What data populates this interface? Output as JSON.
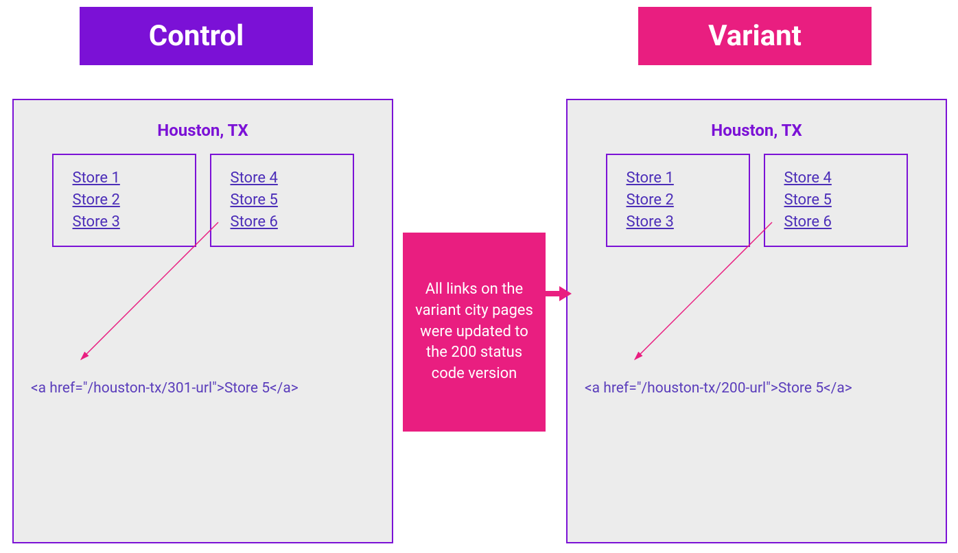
{
  "headers": {
    "control": "Control",
    "variant": "Variant"
  },
  "city": "Houston, TX",
  "stores": {
    "col1": [
      "Store 1",
      "Store 2",
      "Store 3"
    ],
    "col2": [
      "Store 4",
      "Store 5",
      "Store 6"
    ]
  },
  "snippets": {
    "control": "<a href=\"/houston-tx/301-url\">Store 5</a>",
    "variant": "<a href=\"/houston-tx/200-url\">Store 5</a>"
  },
  "callout": "All links on the variant city pages were updated to the 200 status code version"
}
